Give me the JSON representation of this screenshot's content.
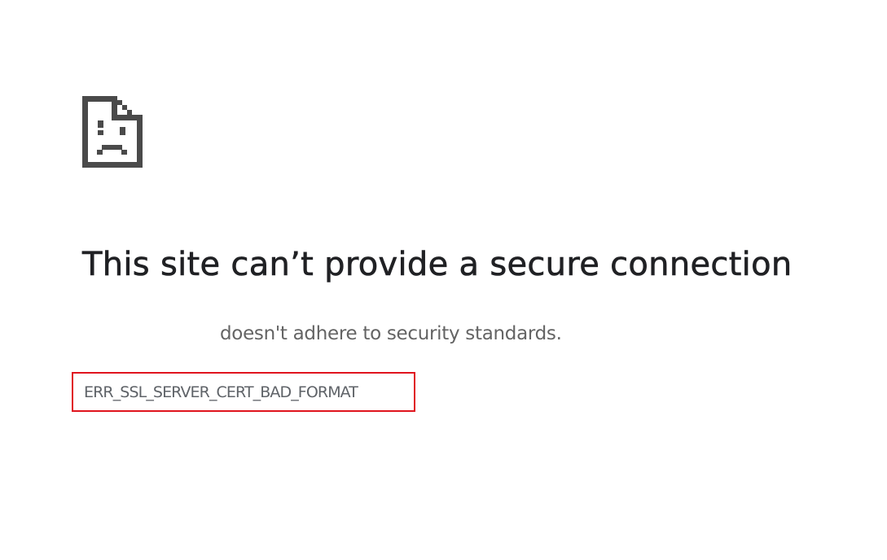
{
  "icon": "sad-file-icon",
  "headline": "This site can’t provide a secure connection",
  "subtext": "doesn't adhere to security standards.",
  "error_code": "ERR_SSL_SERVER_CERT_BAD_FORMAT",
  "colors": {
    "headline": "#202124",
    "subtext": "#646464",
    "error_code": "#5f6368",
    "highlight_box": "#e0141e",
    "icon": "#4a4a4a"
  }
}
